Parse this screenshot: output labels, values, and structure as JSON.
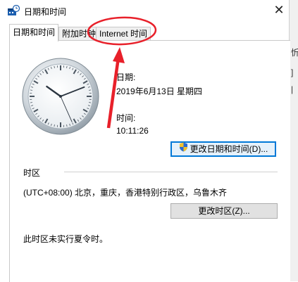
{
  "window": {
    "title": "日期和时间",
    "close_glyph": "✕"
  },
  "tabs": [
    {
      "label": "日期和时间",
      "active": true
    },
    {
      "label": "附加时钟",
      "active": false
    },
    {
      "label": "Internet 时间",
      "active": false
    }
  ],
  "date_time": {
    "date_label": "日期:",
    "date_value": "2019年6月13日 星期四",
    "time_label": "时间:",
    "time_value": "10:11:26",
    "change_button": "更改日期和时间(D)..."
  },
  "clock": {
    "hour": 10,
    "minute": 11,
    "second": 26
  },
  "timezone": {
    "section_label": "时区",
    "value": "(UTC+08:00) 北京，重庆，香港特别行政区，乌鲁木齐",
    "change_button": "更改时区(Z)...",
    "dst_note": "此时区未实行夏令时。"
  },
  "background_window": {
    "chars": [
      "忻",
      "]",
      "|"
    ]
  },
  "colors": {
    "annotation": "#e8202a",
    "focus": "#0078d7"
  }
}
